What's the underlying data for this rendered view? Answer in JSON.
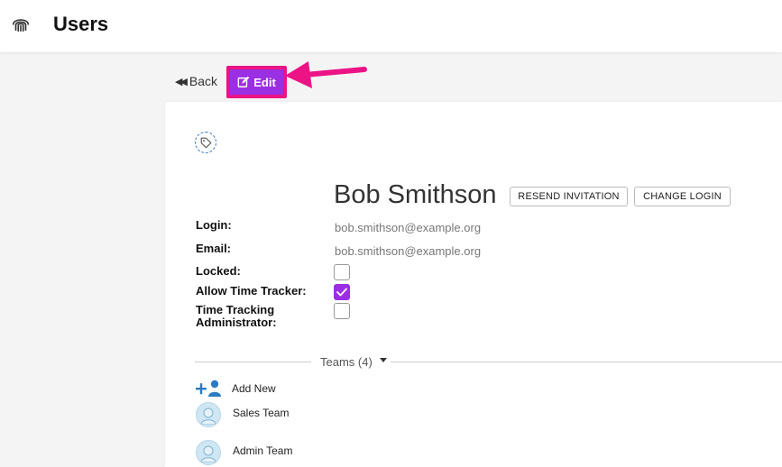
{
  "header": {
    "title": "Users",
    "logo_icon": "fingerprint-icon"
  },
  "toolbar": {
    "back_label": "Back",
    "edit_label": "Edit"
  },
  "user": {
    "name": "Bob Smithson",
    "resend_label": "RESEND INVITATION",
    "change_login_label": "CHANGE LOGIN",
    "fields": {
      "login_label": "Login:",
      "login_value": "bob.smithson@example.org",
      "email_label": "Email:",
      "email_value": "bob.smithson@example.org",
      "locked_label": "Locked:",
      "locked": false,
      "time_tracker_label": "Allow Time Tracker:",
      "time_tracker": true,
      "tt_admin_label_1": "Time Tracking",
      "tt_admin_label_2": "Administrator:",
      "tt_admin": false
    }
  },
  "teams": {
    "heading": "Teams (4)",
    "add_new_label": "Add New",
    "items": [
      {
        "name": "Sales Team"
      },
      {
        "name": "Admin Team"
      }
    ]
  },
  "colors": {
    "accent": "#9a2fe4",
    "highlight": "#ec1385",
    "link_blue": "#3a7bbf"
  }
}
